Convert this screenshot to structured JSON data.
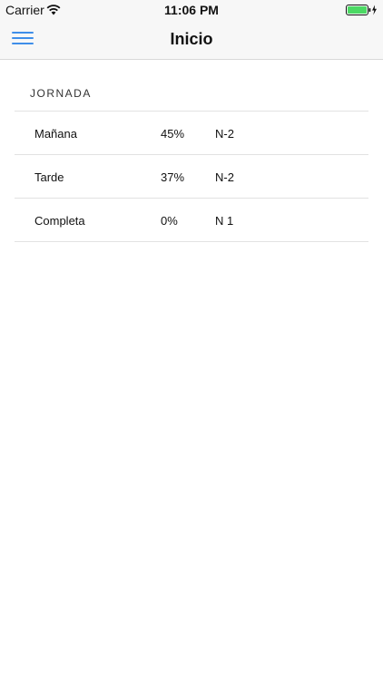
{
  "status_bar": {
    "carrier": "Carrier",
    "time": "11:06 PM",
    "battery_color": "#4cd964"
  },
  "navbar": {
    "title": "Inicio",
    "menu_icon": "hamburger-menu-icon",
    "accent_color": "#3f8ee9"
  },
  "section": {
    "header": "JORNADA",
    "rows": [
      {
        "name": "Mañana",
        "percent": "45%",
        "code": "N-2"
      },
      {
        "name": "Tarde",
        "percent": "37%",
        "code": "N-2"
      },
      {
        "name": "Completa",
        "percent": "0%",
        "code": "N 1"
      }
    ]
  }
}
